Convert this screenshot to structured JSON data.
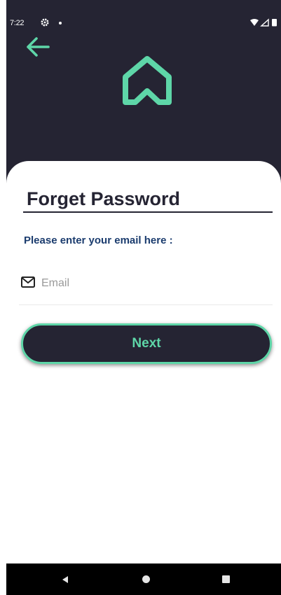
{
  "status_bar": {
    "time": "7:22",
    "icons": [
      "settings-gear-icon",
      "notification-dot-icon",
      "wifi-icon",
      "cellular-signal-icon",
      "battery-icon"
    ]
  },
  "header": {
    "back_icon": "arrow-left-icon",
    "logo_icon": "home-outline-icon"
  },
  "form": {
    "title": "Forget Password",
    "prompt": "Please enter your email here :",
    "email": {
      "icon": "mail-icon",
      "placeholder": "Email",
      "value": ""
    },
    "next_label": "Next"
  },
  "nav_bar": {
    "buttons": [
      "back-triangle-icon",
      "home-circle-icon",
      "recents-square-icon"
    ]
  },
  "colors": {
    "header_background": "#252433",
    "accent": "#5ed6a8",
    "prompt_text": "#1b3c6e",
    "title_text": "#252433"
  }
}
